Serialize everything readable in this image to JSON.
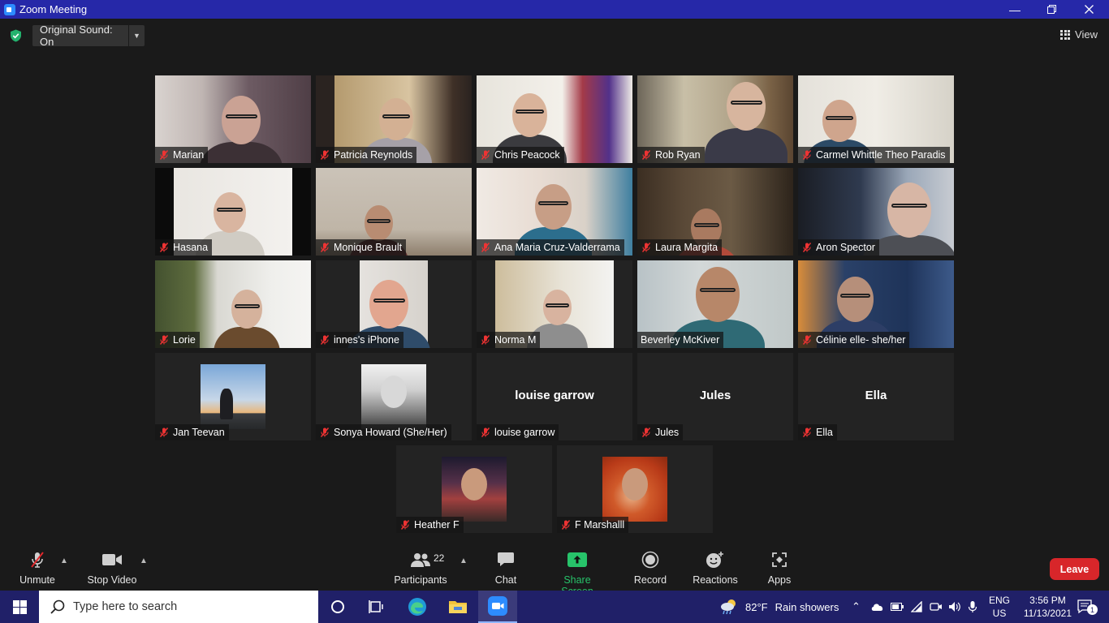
{
  "window": {
    "title": "Zoom Meeting"
  },
  "topbar": {
    "sound_label": "Original Sound: On",
    "view_label": "View"
  },
  "participants": [
    {
      "name": "Marian"
    },
    {
      "name": "Patricia Reynolds"
    },
    {
      "name": "Chris Peacock"
    },
    {
      "name": "Rob Ryan"
    },
    {
      "name": "Carmel Whittle Theo Paradis"
    },
    {
      "name": "Hasana"
    },
    {
      "name": "Monique Brault"
    },
    {
      "name": "Ana Maria Cruz-Valderrama"
    },
    {
      "name": "Laura Margita"
    },
    {
      "name": "Aron Spector"
    },
    {
      "name": "Lorie"
    },
    {
      "name": "innes's iPhone"
    },
    {
      "name": "Norma M"
    },
    {
      "name": "Beverley McKiver",
      "active": true
    },
    {
      "name": "Célinie elle- she/her"
    },
    {
      "name": "Jan Teevan"
    },
    {
      "name": "Sonya Howard (She/Her)"
    },
    {
      "name": "louise garrow",
      "big_name": "louise garrow"
    },
    {
      "name": "Jules",
      "big_name": "Jules"
    },
    {
      "name": "Ella",
      "big_name": "Ella"
    },
    {
      "name": "Heather F"
    },
    {
      "name": "F Marshalll"
    }
  ],
  "toolbar": {
    "unmute": "Unmute",
    "stop_video": "Stop Video",
    "participants": "Participants",
    "participants_count": "22",
    "chat": "Chat",
    "share_screen": "Share Screen",
    "record": "Record",
    "reactions": "Reactions",
    "apps": "Apps",
    "leave": "Leave"
  },
  "taskbar": {
    "search_placeholder": "Type here to search",
    "weather_temp": "82°F",
    "weather_desc": "Rain showers",
    "lang_top": "ENG",
    "lang_bottom": "US",
    "time": "3:56 PM",
    "date": "11/13/2021",
    "notifications": "1"
  },
  "colors": {
    "titlebar": "#2628a8",
    "active_border": "#e3e36b",
    "leave": "#d8262a",
    "share_green": "#27c36a",
    "taskbar": "#202068"
  }
}
